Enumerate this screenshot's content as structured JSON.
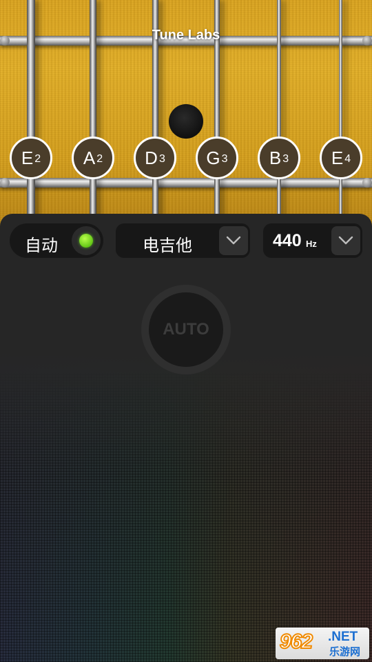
{
  "app": {
    "title": "Tune Labs"
  },
  "strings": [
    {
      "note": "E",
      "octave": "2"
    },
    {
      "note": "A",
      "octave": "2"
    },
    {
      "note": "D",
      "octave": "3"
    },
    {
      "note": "G",
      "octave": "3"
    },
    {
      "note": "B",
      "octave": "3"
    },
    {
      "note": "E",
      "octave": "4"
    }
  ],
  "controls": {
    "mode_label": "自动",
    "mode_indicator_color": "#5fd11a",
    "instrument_label": "电吉他",
    "frequency_value": "440",
    "frequency_unit": "Hz",
    "dropdown_icon": "chevron-down-icon"
  },
  "tuner": {
    "auto_label": "AUTO"
  },
  "watermark": {
    "number": "962",
    "suffix": ".NET",
    "site": "乐游网"
  },
  "colors": {
    "fretboard": "#e0a820",
    "panel": "#262626",
    "note_button": "#4a3d2a"
  }
}
